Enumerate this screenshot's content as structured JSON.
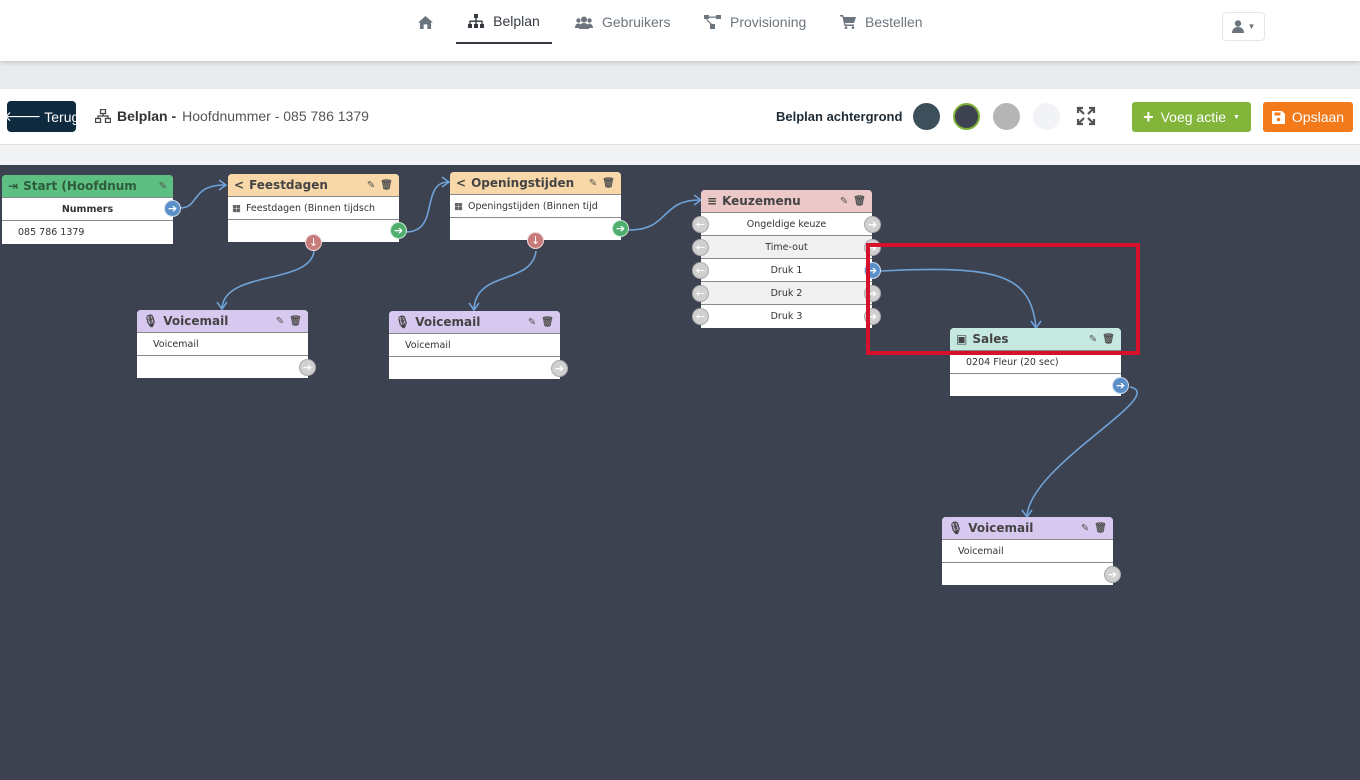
{
  "nav": {
    "home_icon": "home-icon",
    "items": [
      {
        "label": "Belplan",
        "icon": "sitemap-icon",
        "active": true
      },
      {
        "label": "Gebruikers",
        "icon": "users-icon",
        "active": false
      },
      {
        "label": "Provisioning",
        "icon": "provisioning-icon",
        "active": false
      },
      {
        "label": "Bestellen",
        "icon": "cart-icon",
        "active": false
      }
    ],
    "user_icon": "user-icon"
  },
  "toolbar": {
    "back_label": "Terug",
    "crumb_bold": "Belplan -",
    "crumb_rest": "Hoofdnummer - 085 786 1379",
    "bg_label": "Belplan achtergrond",
    "bg_colors": [
      "#3c4f5a",
      "#3c4250",
      "#b5b5b5",
      "#f2f3f6"
    ],
    "bg_selected": 1,
    "add_label": "Voeg actie",
    "save_label": "Opslaan",
    "add_color": "#82b53a",
    "save_color": "#f27a1a"
  },
  "nodes": {
    "start": {
      "title": "Start (Hoofdnum",
      "header": "Nummers",
      "number": "085 786 1379",
      "color": "#5ebf82"
    },
    "feestdagen": {
      "title": "Feestdagen",
      "row": "Feestdagen (Binnen tijdsch",
      "color": "#f8d8a8"
    },
    "openingstijden": {
      "title": "Openingstijden",
      "row": "Openingstijden (Binnen tijd",
      "color": "#f8d8a8"
    },
    "keuzemenu": {
      "title": "Keuzemenu",
      "options": [
        "Ongeldige keuze",
        "Time-out",
        "Druk 1",
        "Druk 2",
        "Druk 3"
      ],
      "color": "#ecc8c8"
    },
    "sales": {
      "title": "Sales",
      "row": "0204 Fleur (20 sec)",
      "color": "#c5e8e0"
    },
    "vm1": {
      "title": "Voicemail",
      "row": "Voicemail",
      "color": "#d6c8ef"
    },
    "vm2": {
      "title": "Voicemail",
      "row": "Voicemail",
      "color": "#d6c8ef"
    },
    "vm3": {
      "title": "Voicemail",
      "row": "Voicemail",
      "color": "#d6c8ef"
    }
  },
  "highlight_color": "#d7112b"
}
